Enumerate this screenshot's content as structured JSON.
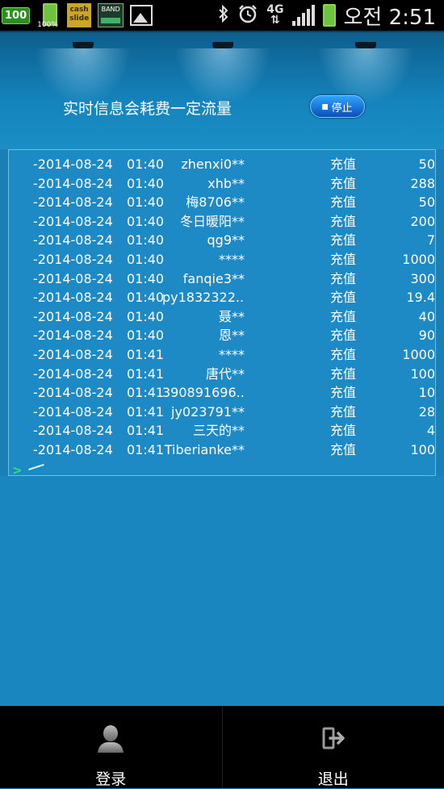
{
  "status_bar": {
    "battery_badge": "100",
    "battery_percent": "100%",
    "cash_slide": "cash\nslide",
    "band_label": "BAND",
    "network": "4G",
    "time": "오전 2:51"
  },
  "header": {
    "info_text": "实时信息会耗费一定流量",
    "stop_label": "停止"
  },
  "records": [
    {
      "date": "-2014-08-24",
      "time": "01:40",
      "user": "zhenxi0**",
      "type": "充值",
      "amount": "50"
    },
    {
      "date": "-2014-08-24",
      "time": "01:40",
      "user": "xhb**",
      "type": "充值",
      "amount": "288"
    },
    {
      "date": "-2014-08-24",
      "time": "01:40",
      "user": "梅8706**",
      "type": "充值",
      "amount": "50"
    },
    {
      "date": "-2014-08-24",
      "time": "01:40",
      "user": "冬日暖阳**",
      "type": "充值",
      "amount": "200"
    },
    {
      "date": "-2014-08-24",
      "time": "01:40",
      "user": "qg9**",
      "type": "充值",
      "amount": "7"
    },
    {
      "date": "-2014-08-24",
      "time": "01:40",
      "user": "****",
      "type": "充值",
      "amount": "1000"
    },
    {
      "date": "-2014-08-24",
      "time": "01:40",
      "user": "fanqie3**",
      "type": "充值",
      "amount": "300"
    },
    {
      "date": "-2014-08-24",
      "time": "01:40",
      "user": "py1832322...",
      "type": "充值",
      "amount": "19.4"
    },
    {
      "date": "-2014-08-24",
      "time": "01:40",
      "user": "聂**",
      "type": "充值",
      "amount": "40"
    },
    {
      "date": "-2014-08-24",
      "time": "01:40",
      "user": "恩**",
      "type": "充值",
      "amount": "90"
    },
    {
      "date": "-2014-08-24",
      "time": "01:41",
      "user": "****",
      "type": "充值",
      "amount": "1000"
    },
    {
      "date": "-2014-08-24",
      "time": "01:41",
      "user": "唐代**",
      "type": "充值",
      "amount": "100"
    },
    {
      "date": "-2014-08-24",
      "time": "01:41",
      "user": "390891696...",
      "type": "充值",
      "amount": "10"
    },
    {
      "date": "-2014-08-24",
      "time": "01:41",
      "user": "jy023791**",
      "type": "充值",
      "amount": "28"
    },
    {
      "date": "-2014-08-24",
      "time": "01:41",
      "user": "三天的**",
      "type": "充值",
      "amount": "4"
    },
    {
      "date": "-2014-08-24",
      "time": "01:41",
      "user": "Tiberianke**",
      "type": "充值",
      "amount": "100"
    }
  ],
  "console": {
    "prompt": ">"
  },
  "bottom_nav": {
    "login_label": "登录",
    "logout_label": "退出"
  },
  "colors": {
    "background": "#1a7fb5",
    "panel": "#1d8ac6",
    "prompt": "#3ee06a",
    "stop_button": "#1a7fe0"
  }
}
